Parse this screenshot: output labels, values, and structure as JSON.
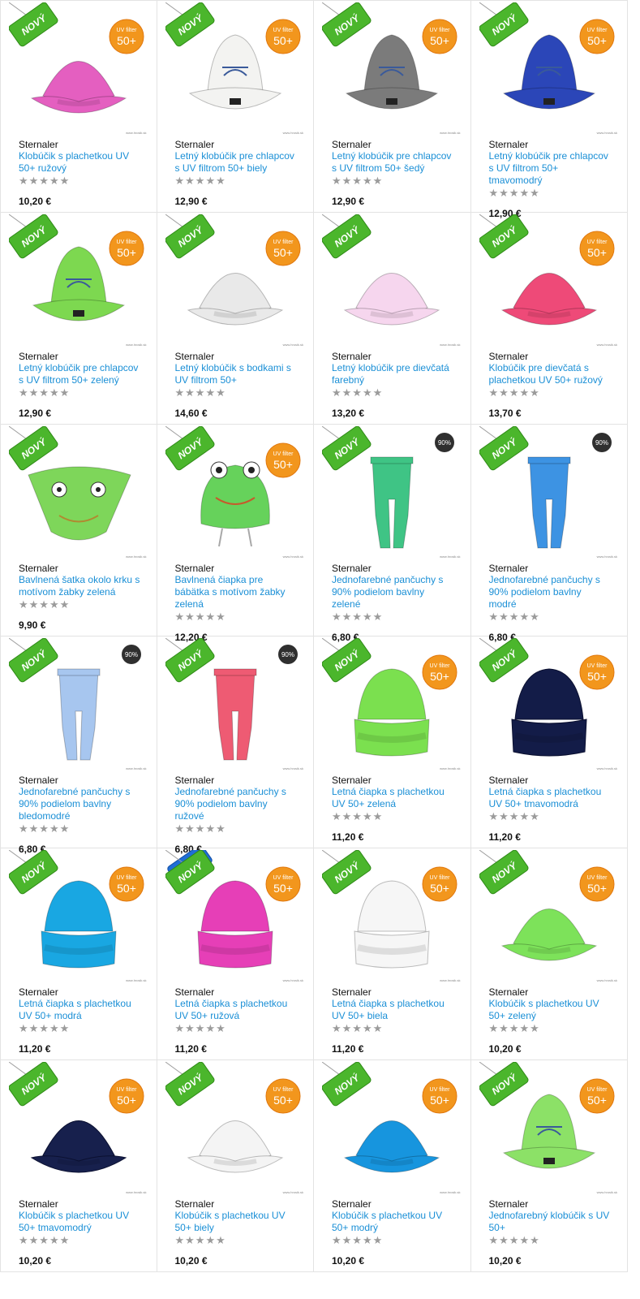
{
  "products": [
    {
      "brand": "Sternaler",
      "name": "Klobúčik s plachetkou UV 50+ ružový",
      "price": "10,20 €",
      "rating": "★★★★★",
      "badge": "NOVÝ",
      "uv": "UV filter 50+",
      "color": "#e45fc0",
      "kind": "hat",
      "lines": 2
    },
    {
      "brand": "Sternaler",
      "name": "Letný klobúčik pre chlapcov s UV filtrom 50+ biely",
      "price": "12,90 €",
      "rating": "★★★★★",
      "badge": "NOVÝ",
      "uv": "UV filter 50+",
      "color": "#f3f3f1",
      "kind": "bucket",
      "lines": 2
    },
    {
      "brand": "Sternaler",
      "name": "Letný klobúčik pre chlapcov s UV filtrom 50+ šedý",
      "price": "12,90 €",
      "rating": "★★★★★",
      "badge": "NOVÝ",
      "uv": "UV filter 50+",
      "color": "#7b7b7b",
      "kind": "bucket",
      "lines": 2
    },
    {
      "brand": "Sternaler",
      "name": "Letný klobúčik pre chlapcov s UV filtrom 50+ tmavomodrý",
      "price": "12,90 €",
      "rating": "★★★★★",
      "badge": "NOVÝ",
      "uv": "UV filter 50+",
      "color": "#2b46b8",
      "kind": "bucket",
      "lines": 3
    },
    {
      "brand": "Sternaler",
      "name": "Letný klobúčik pre chlapcov s UV filtrom 50+ zelený",
      "price": "12,90 €",
      "rating": "★★★★★",
      "badge": "NOVÝ",
      "uv": "UV filter 50+",
      "color": "#7dd850",
      "kind": "bucket",
      "lines": 2
    },
    {
      "brand": "Sternaler",
      "name": "Letný klobúčik s bodkami s UV filtrom 50+",
      "price": "14,60 €",
      "rating": "★★★★★",
      "badge": "NOVÝ",
      "uv": "UV filter 50+",
      "color": "#e9e9e9",
      "kind": "hat",
      "lines": 2
    },
    {
      "brand": "Sternaler",
      "name": "Letný klobúčik pre dievčatá farebný",
      "price": "13,20 €",
      "rating": "★★★★★",
      "badge": "NOVÝ",
      "uv": "",
      "color": "#f6d6ee",
      "kind": "hat",
      "lines": 2
    },
    {
      "brand": "Sternaler",
      "name": "Klobúčik pre dievčatá s plachetkou UV 50+ ružový",
      "price": "13,70 €",
      "rating": "★★★★★",
      "badge": "NOVÝ",
      "uv": "UV filter 50+",
      "color": "#ee4a78",
      "kind": "hat",
      "lines": 2
    },
    {
      "brand": "Sternaler",
      "name": "Bavlnená šatka okolo krku s motívom žabky zelená",
      "price": "9,90 €",
      "rating": "★★★★★",
      "badge": "NOVÝ",
      "uv": "",
      "color": "#7ed65a",
      "kind": "scarf",
      "lines": 2
    },
    {
      "brand": "Sternaler",
      "name": "Bavlnená čiapka pre bábätka s motívom žabky zelená",
      "price": "12,20 €",
      "rating": "★★★★★",
      "badge": "NOVÝ",
      "uv": "UV filter 50+",
      "color": "#66d25b",
      "kind": "frog",
      "lines": 3
    },
    {
      "brand": "Sternaler",
      "name": "Jednofarebné pančuchy s 90% podielom bavlny zelené",
      "price": "6,80 €",
      "rating": "★★★★★",
      "badge": "NOVÝ",
      "uv": "",
      "cotton": "90%",
      "color": "#3fc485",
      "kind": "tights",
      "lines": 3
    },
    {
      "brand": "Sternaler",
      "name": "Jednofarebné pančuchy s 90% podielom bavlny modré",
      "price": "6,80 €",
      "rating": "★★★★★",
      "badge": "NOVÝ",
      "uv": "",
      "cotton": "90%",
      "color": "#3d93e3",
      "kind": "tights",
      "lines": 3
    },
    {
      "brand": "Sternaler",
      "name": "Jednofarebné pančuchy s 90% podielom bavlny bledomodré",
      "price": "6,80 €",
      "rating": "★★★★★",
      "badge": "NOVÝ",
      "uv": "",
      "cotton": "90%",
      "color": "#a7c6ef",
      "kind": "tights",
      "lines": 3
    },
    {
      "brand": "Sternaler",
      "name": "Jednofarebné pančuchy s 90% podielom bavlny ružové",
      "price": "6,80 €",
      "rating": "★★★★★",
      "badge": "NOVÝ",
      "uv": "",
      "cotton": "90%",
      "color": "#ee5b73",
      "kind": "tights",
      "lines": 3
    },
    {
      "brand": "Sternaler",
      "name": "Letná čiapka s plachetkou UV 50+ zelená",
      "price": "11,20 €",
      "rating": "★★★★★",
      "badge": "NOVÝ",
      "uv": "UV filter 50+",
      "color": "#7be04f",
      "kind": "cap",
      "lines": 2
    },
    {
      "brand": "Sternaler",
      "name": "Letná čiapka s plachetkou UV 50+ tmavomodrá",
      "price": "11,20 €",
      "rating": "★★★★★",
      "badge": "NOVÝ",
      "uv": "UV filter 50+",
      "color": "#131c48",
      "kind": "cap",
      "lines": 2
    },
    {
      "brand": "Sternaler",
      "name": "Letná čiapka s plachetkou UV 50+ modrá",
      "price": "11,20 €",
      "rating": "★★★★★",
      "badge": "NOVÝ",
      "uv": "UV filter 50+",
      "color": "#19a7e2",
      "kind": "cap",
      "lines": 2
    },
    {
      "brand": "Sternaler",
      "name": "Letná čiapka s plachetkou UV 50+ ružová",
      "price": "11,20 €",
      "rating": "★★★★★",
      "badge": "NOVÝ",
      "top": "TOP",
      "uv": "UV filter 50+",
      "color": "#e63fb7",
      "kind": "cap",
      "lines": 2
    },
    {
      "brand": "Sternaler",
      "name": "Letná čiapka s plachetkou UV 50+ biela",
      "price": "11,20 €",
      "rating": "★★★★★",
      "badge": "NOVÝ",
      "uv": "UV filter 50+",
      "color": "#f6f6f6",
      "kind": "cap",
      "lines": 2
    },
    {
      "brand": "Sternaler",
      "name": "Klobúčik s plachetkou UV 50+ zelený",
      "price": "10,20 €",
      "rating": "★★★★★",
      "badge": "NOVÝ",
      "uv": "UV filter 50+",
      "color": "#7de25a",
      "kind": "hat",
      "lines": 2
    },
    {
      "brand": "Sternaler",
      "name": "Klobúčik s plachetkou UV 50+ tmavomodrý",
      "price": "10,20 €",
      "rating": "★★★★★",
      "badge": "NOVÝ",
      "uv": "UV filter 50+",
      "color": "#17204d",
      "kind": "hat",
      "lines": 2
    },
    {
      "brand": "Sternaler",
      "name": "Klobúčik s plachetkou UV 50+ biely",
      "price": "10,20 €",
      "rating": "★★★★★",
      "badge": "NOVÝ",
      "uv": "UV filter 50+",
      "color": "#f4f4f4",
      "kind": "hat",
      "lines": 2
    },
    {
      "brand": "Sternaler",
      "name": "Klobúčik s plachetkou UV 50+ modrý",
      "price": "10,20 €",
      "rating": "★★★★★",
      "badge": "NOVÝ",
      "uv": "UV filter 50+",
      "color": "#1795de",
      "kind": "hat",
      "lines": 2
    },
    {
      "brand": "Sternaler",
      "name": "Jednofarebný klobúčik s UV 50+",
      "price": "10,20 €",
      "rating": "★★★★★",
      "badge": "NOVÝ",
      "uv": "UV filter 50+",
      "color": "#8ce167",
      "kind": "bucket",
      "lines": 2
    }
  ],
  "watermark": "www.hrosik.sk"
}
